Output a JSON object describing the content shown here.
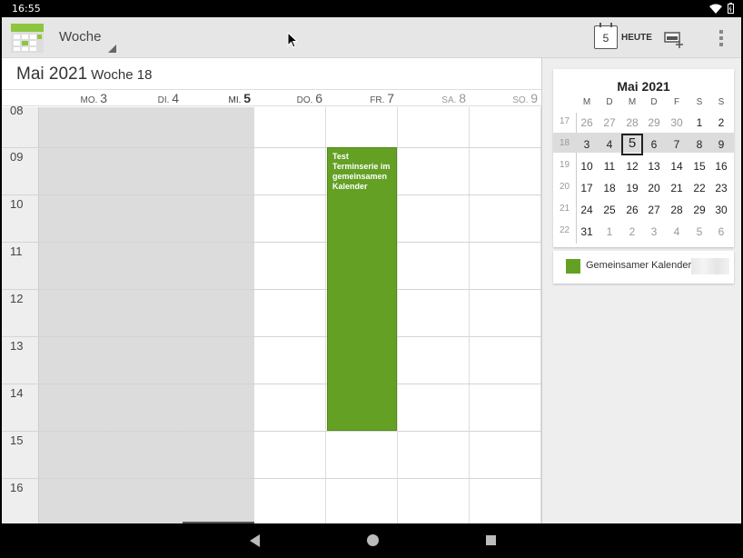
{
  "status": {
    "time": "16:55"
  },
  "actionbar": {
    "view_label": "Woche",
    "today_day": "5",
    "today_label": "HEUTE"
  },
  "week": {
    "month_title": "Mai 2021",
    "week_label": "Woche 18",
    "days": [
      {
        "name": "MO.",
        "num": "3"
      },
      {
        "name": "DI.",
        "num": "4"
      },
      {
        "name": "MI.",
        "num": "5"
      },
      {
        "name": "DO.",
        "num": "6"
      },
      {
        "name": "FR.",
        "num": "7"
      },
      {
        "name": "SA.",
        "num": "8"
      },
      {
        "name": "SO.",
        "num": "9"
      }
    ],
    "hours": [
      "08",
      "09",
      "10",
      "11",
      "12",
      "13",
      "14",
      "15",
      "16"
    ],
    "event": {
      "title": "Test Terminserie im gemeinsamen Kalender",
      "day": "FR. 7",
      "start": "09:00",
      "end": "15:00",
      "color": "#64a024"
    }
  },
  "minical": {
    "title": "Mai 2021",
    "dow": [
      "M",
      "D",
      "M",
      "D",
      "F",
      "S",
      "S"
    ],
    "weeks": [
      {
        "wn": "17",
        "days": [
          "26",
          "27",
          "28",
          "29",
          "30",
          "1",
          "2"
        ]
      },
      {
        "wn": "18",
        "days": [
          "3",
          "4",
          "5",
          "6",
          "7",
          "8",
          "9"
        ]
      },
      {
        "wn": "19",
        "days": [
          "10",
          "11",
          "12",
          "13",
          "14",
          "15",
          "16"
        ]
      },
      {
        "wn": "20",
        "days": [
          "17",
          "18",
          "19",
          "20",
          "21",
          "22",
          "23"
        ]
      },
      {
        "wn": "21",
        "days": [
          "24",
          "25",
          "26",
          "27",
          "28",
          "29",
          "30"
        ]
      },
      {
        "wn": "22",
        "days": [
          "31",
          "1",
          "2",
          "3",
          "4",
          "5",
          "6"
        ]
      }
    ],
    "today": "5"
  },
  "legend": {
    "label": "Gemeinsamer Kalender",
    "color": "#64a024"
  }
}
